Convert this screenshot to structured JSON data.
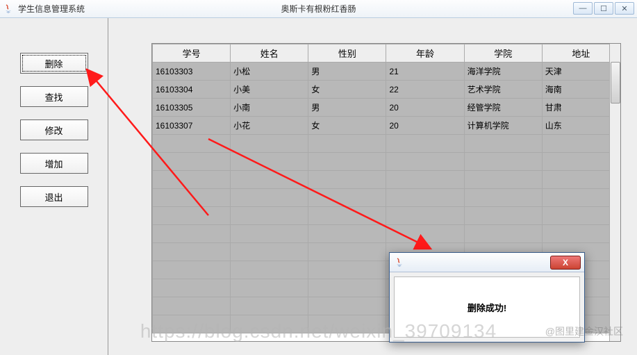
{
  "window": {
    "title": "学生信息管理系统",
    "center_title": "奥斯卡有根粉红香肠",
    "min_glyph": "—",
    "max_glyph": "☐",
    "close_glyph": "✕"
  },
  "sidebar": {
    "buttons": [
      {
        "id": "delete",
        "label": "删除",
        "focused": true
      },
      {
        "id": "search",
        "label": "查找",
        "focused": false
      },
      {
        "id": "modify",
        "label": "修改",
        "focused": false
      },
      {
        "id": "add",
        "label": "增加",
        "focused": false
      },
      {
        "id": "exit",
        "label": "退出",
        "focused": false
      }
    ]
  },
  "table": {
    "columns": [
      "学号",
      "姓名",
      "性别",
      "年龄",
      "学院",
      "地址"
    ],
    "rows": [
      [
        "16103303",
        "小松",
        "男",
        "21",
        "海洋学院",
        "天津"
      ],
      [
        "16103304",
        "小美",
        "女",
        "22",
        "艺术学院",
        "海南"
      ],
      [
        "16103305",
        "小南",
        "男",
        "20",
        "经管学院",
        "甘肃"
      ],
      [
        "16103307",
        "小花",
        "女",
        "20",
        "计算机学院",
        "山东"
      ]
    ],
    "empty_rows": 11
  },
  "dialog": {
    "message": "删除成功!",
    "close_glyph": "X"
  },
  "watermark": {
    "main": "https://blog.csdn.net/weixin_39709134",
    "side": "@图里建金汉社区"
  }
}
